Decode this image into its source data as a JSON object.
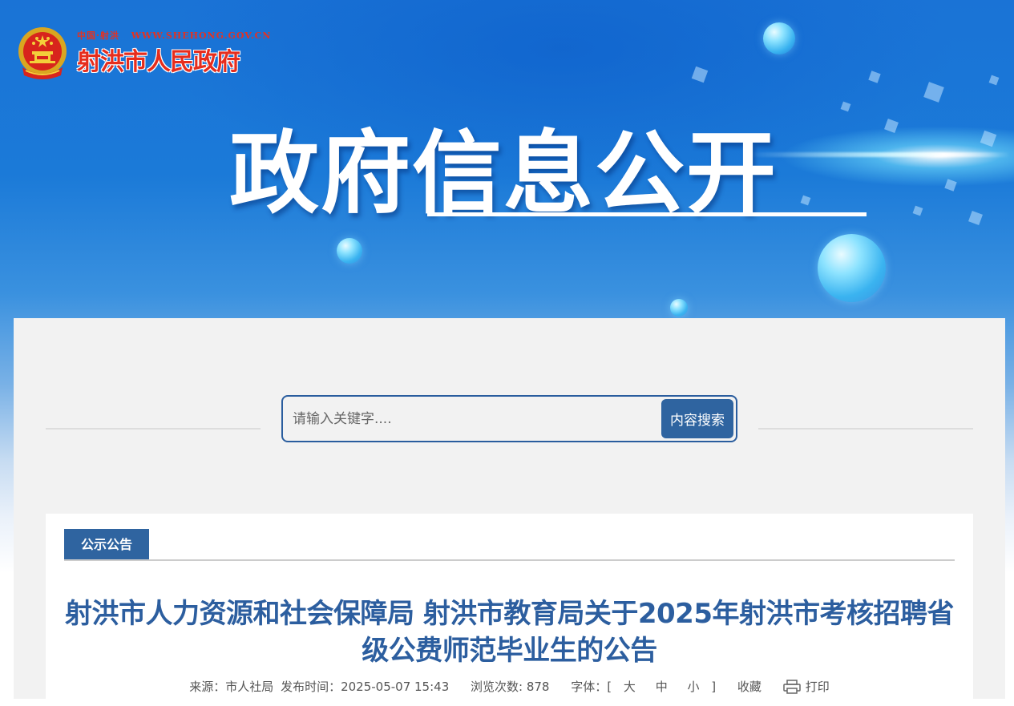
{
  "site": {
    "logo_top_left": "中国·射洪",
    "logo_url": "WWW.SHEHONG.GOV.CN",
    "logo_name": "射洪市人民政府"
  },
  "banner": {
    "title": "政府信息公开"
  },
  "search": {
    "placeholder": "请输入关键字....",
    "button_label": "内容搜索"
  },
  "section": {
    "tab_label": "公示公告"
  },
  "article": {
    "title": "射洪市人力资源和社会保障局 射洪市教育局关于2025年射洪市考核招聘省级公费师范毕业生的公告",
    "source": "来源：市人社局",
    "published": "发布时间：2025-05-07 15:43",
    "views": "浏览次数: 878",
    "font_label": "字体：[",
    "font_close": "]",
    "font_large": "大",
    "font_medium": "中",
    "font_small": "小",
    "favorite_label": "收藏",
    "print_label": "打印"
  },
  "colors": {
    "accent": "#2f64a0",
    "title": "#2c5e9f",
    "logo_red": "#e62d1d"
  }
}
